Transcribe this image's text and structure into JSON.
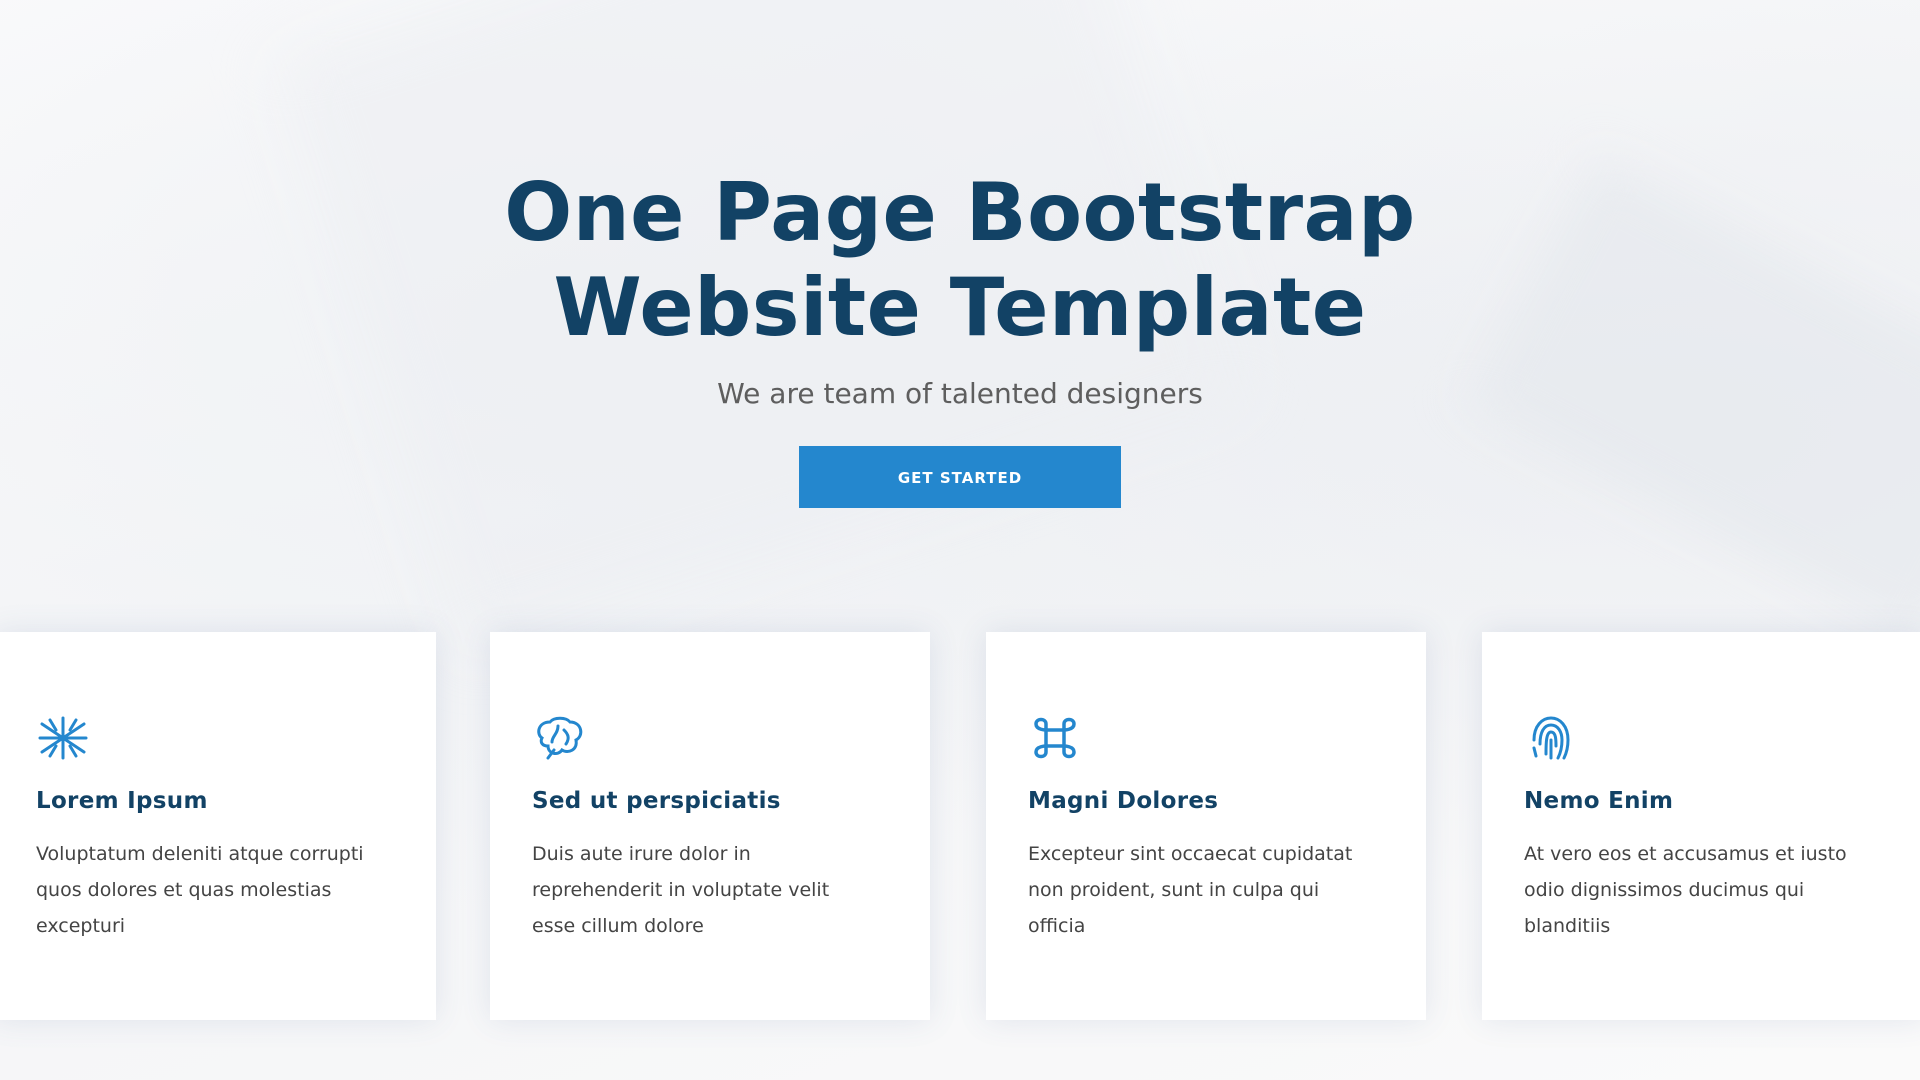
{
  "hero": {
    "title_line_1": "One Page Bootstrap",
    "title_line_2": "Website Template",
    "subtitle": "We are team of talented designers",
    "cta_label": "Get Started"
  },
  "cards": [
    {
      "icon": "dribbble-icon",
      "title": "Lorem Ipsum",
      "text": "Voluptatum deleniti atque corrupti quos dolores et quas molestias excepturi"
    },
    {
      "icon": "brain-icon",
      "title": "Sed ut perspiciatis",
      "text": "Duis aute irure dolor in reprehenderit in voluptate velit esse cillum dolore"
    },
    {
      "icon": "command-icon",
      "title": "Magni Dolores",
      "text": "Excepteur sint occaecat cupidatat non proident, sunt in culpa qui officia"
    },
    {
      "icon": "fingerprint-icon",
      "title": "Nemo Enim",
      "text": "At vero eos et accusamus et iusto odio dignissimos ducimus qui blanditiis"
    }
  ],
  "colors": {
    "title": "#124265",
    "accent": "#2487ce",
    "subtitle": "#5e5e5e",
    "body_text": "#444444"
  }
}
